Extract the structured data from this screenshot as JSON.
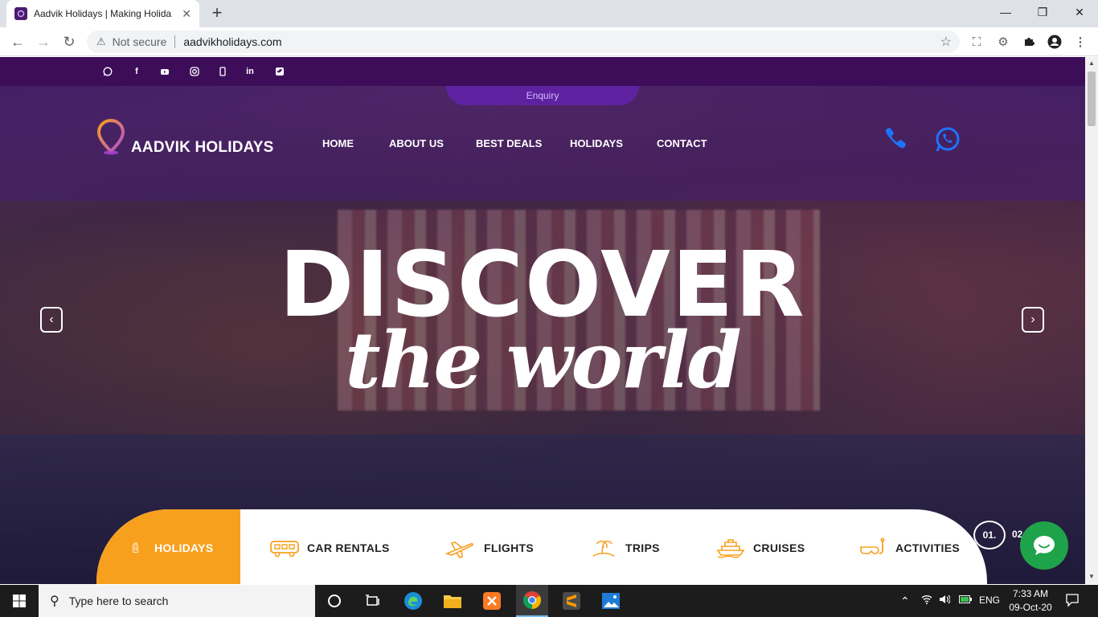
{
  "browser": {
    "tab_title": "Aadvik Holidays | Making Holida",
    "new_tab": "+",
    "security_label": "Not secure",
    "url": "aadvikholidays.com",
    "window_controls": [
      "minimize-icon",
      "restore-icon",
      "close-icon"
    ]
  },
  "site": {
    "social_icons": [
      "whatsapp-icon",
      "facebook-icon",
      "youtube-icon",
      "instagram-icon",
      "mobile-icon",
      "linkedin-icon",
      "twitter-icon"
    ],
    "enquiry_label": "Enquiry",
    "brand": "AADVIK HOLIDAYS",
    "menu": [
      "HOME",
      "ABOUT US",
      "BEST DEALS",
      "HOLIDAYS",
      "CONTACT"
    ],
    "hero_line1": "DISCOVER",
    "hero_line2": "the world",
    "prev_arrow": "‹",
    "next_arrow": "›",
    "booking_tabs": [
      {
        "label": "HOLIDAYS",
        "icon": "luggage-icon"
      },
      {
        "label": "CAR RENTALS",
        "icon": "bus-icon"
      },
      {
        "label": "FLIGHTS",
        "icon": "plane-icon"
      },
      {
        "label": "TRIPS",
        "icon": "island-icon"
      },
      {
        "label": "CRUISES",
        "icon": "ship-icon"
      },
      {
        "label": "ACTIVITIES",
        "icon": "snorkel-icon"
      }
    ],
    "slide_current": "01.",
    "slide_next": "02",
    "colors": {
      "purple": "#3d0d5a",
      "orange": "#f7a01e",
      "chat_green": "#1fa34a",
      "phone_blue": "#1e73ff"
    }
  },
  "taskbar": {
    "search_placeholder": "Type here to search",
    "language": "ENG",
    "time": "7:33 AM",
    "date": "09-Oct-20"
  }
}
